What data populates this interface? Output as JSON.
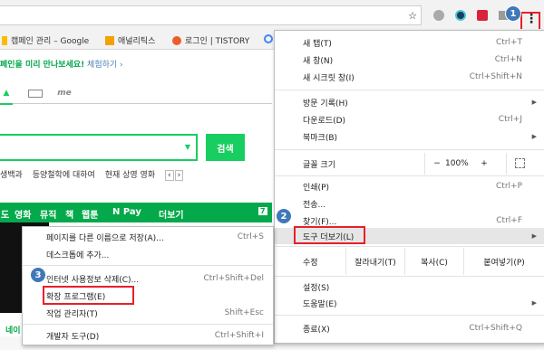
{
  "bookmarks": [
    {
      "label": "캠페인 관리 – Google",
      "icon": "adwords-icon",
      "color": "#fbbc05"
    },
    {
      "label": "애널리틱스",
      "icon": "analytics-icon",
      "color": "#f4a100"
    },
    {
      "label": "로그인 | TISTORY",
      "icon": "tistory-icon",
      "color": "#ec5d2a"
    }
  ],
  "page": {
    "promo_text": "페인을 미리 만나보세요!",
    "promo_link": "체험하기 ›",
    "tab_me": "me",
    "search_button": "검색",
    "keywords": [
      "생백과",
      "등양철학에 대하여",
      "현재 상영 영화"
    ],
    "green_nav": [
      "도",
      "영화",
      "뮤직",
      "책",
      "웹툰",
      "N Pay",
      "더보기"
    ],
    "green_nav_page": "7",
    "left_label": "네이"
  },
  "main_menu": {
    "items": [
      {
        "label": "새 탭(T)",
        "shortcut": "Ctrl+T"
      },
      {
        "label": "새 창(N)",
        "shortcut": "Ctrl+N"
      },
      {
        "label": "새 시크릿 창(I)",
        "shortcut": "Ctrl+Shift+N"
      },
      {
        "label": "방문 기록(H)",
        "shortcut": "",
        "submenu": true
      },
      {
        "label": "다운로드(D)",
        "shortcut": "Ctrl+J"
      },
      {
        "label": "북마크(B)",
        "shortcut": "",
        "submenu": true
      },
      {
        "label": "인쇄(P)",
        "shortcut": "Ctrl+P"
      },
      {
        "label": "전송...",
        "shortcut": ""
      },
      {
        "label": "찾기(F)...",
        "shortcut": "Ctrl+F"
      },
      {
        "label": "도구 더보기(L)",
        "shortcut": "",
        "submenu": true
      },
      {
        "label": "설정(S)",
        "shortcut": ""
      },
      {
        "label": "도움말(E)",
        "shortcut": "",
        "submenu": true
      },
      {
        "label": "종료(X)",
        "shortcut": "Ctrl+Shift+Q"
      }
    ],
    "zoom": {
      "label": "글꼴 크기",
      "minus": "−",
      "value": "100%",
      "plus": "+",
      "fullscreen_icon": "fullscreen-icon"
    },
    "edit": {
      "label": "수정",
      "cut": "잘라내기(T)",
      "copy": "복사(C)",
      "paste": "붙여넣기(P)"
    }
  },
  "sub_menu": {
    "items": [
      {
        "label": "페이지를 다른 이름으로 저장(A)...",
        "shortcut": "Ctrl+S"
      },
      {
        "label": "데스크톱에 추가...",
        "shortcut": ""
      },
      {
        "label": "인터넷 사용정보 삭제(C)...",
        "shortcut": "Ctrl+Shift+Del"
      },
      {
        "label": "확장 프로그램(E)",
        "shortcut": ""
      },
      {
        "label": "작업 관리자(T)",
        "shortcut": "Shift+Esc"
      },
      {
        "label": "개발자 도구(D)",
        "shortcut": "Ctrl+Shift+I"
      }
    ]
  },
  "callouts": [
    "1",
    "2",
    "3"
  ],
  "colors": {
    "naver_green": "#19ce60",
    "callout_blue": "#3f78b9",
    "highlight_red": "#e8202a"
  }
}
